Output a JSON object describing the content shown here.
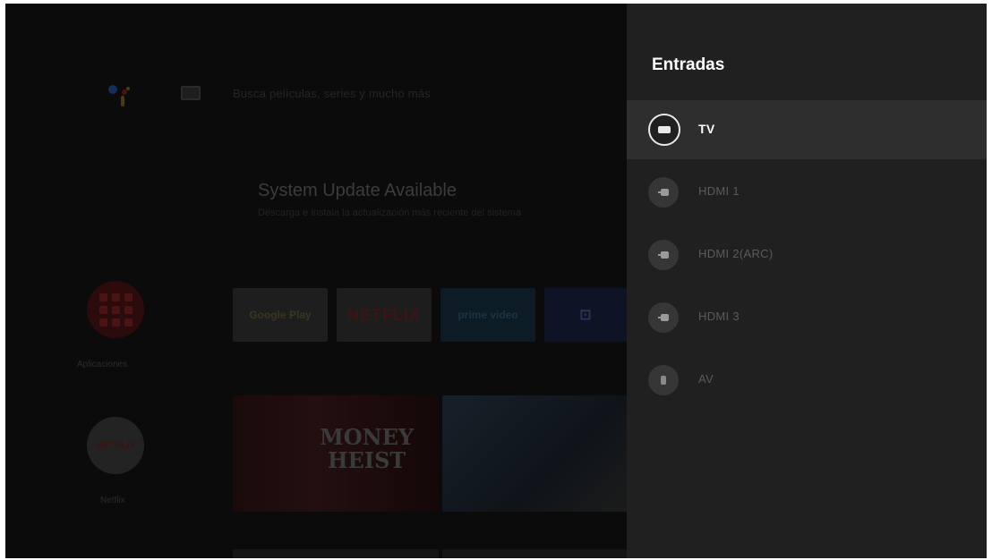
{
  "home": {
    "search_hint": "Busca películas, series y mucho más",
    "update": {
      "title": "System Update Available",
      "subtitle": "Descarga e instala la actualización más reciente del sistema"
    },
    "side_apps": [
      {
        "label": "Aplicaciones"
      },
      {
        "label": "Netflix",
        "badge": "NETFLIX"
      }
    ],
    "app_tiles": [
      "Google Play",
      "NETFLIX",
      "prime video",
      "⊡"
    ],
    "posters": [
      {
        "title_line1": "MONEY",
        "title_line2": "HEIST"
      }
    ]
  },
  "panel": {
    "title": "Entradas",
    "inputs": [
      {
        "label": "TV",
        "icon": "tv-icon",
        "selected": true
      },
      {
        "label": "HDMI 1",
        "icon": "hdmi-icon",
        "selected": false
      },
      {
        "label": "HDMI 2(ARC)",
        "icon": "hdmi-icon",
        "selected": false
      },
      {
        "label": "HDMI 3",
        "icon": "hdmi-icon",
        "selected": false
      },
      {
        "label": "AV",
        "icon": "av-icon",
        "selected": false
      }
    ]
  },
  "colors": {
    "panel_bg": "#202020",
    "selected_row": "#2e2e2e",
    "text_primary": "#ffffff"
  }
}
